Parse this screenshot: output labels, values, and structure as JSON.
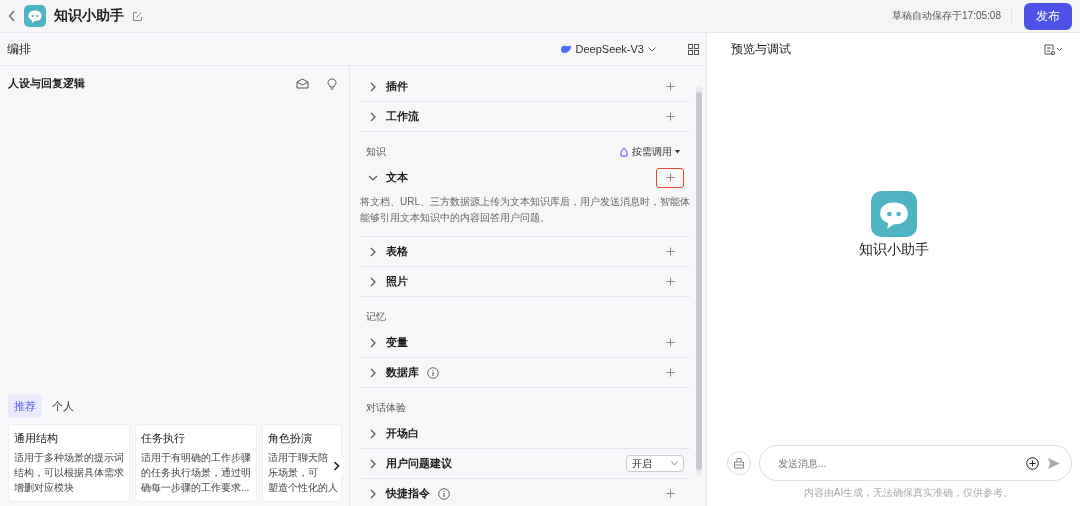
{
  "header": {
    "title": "知识小助手",
    "autosave": "草稿自动保存于17:05:08",
    "publish": "发布"
  },
  "arrange": {
    "title": "编排",
    "model": "DeepSeek-V3"
  },
  "prompt": {
    "title": "人设与回复逻辑",
    "tabs": [
      {
        "label": "推荐",
        "selected": true
      },
      {
        "label": "个人",
        "selected": false
      }
    ],
    "templates": [
      {
        "title": "通用结构",
        "lines": [
          "适用于多种场景的提示词",
          "结构，可以根据具体需求",
          "增删对应模块"
        ]
      },
      {
        "title": "任务执行",
        "lines": [
          "适用于有明确的工作步骤",
          "的任务执行场景，通过明",
          "确每一步骤的工作要求..."
        ]
      },
      {
        "title": "角色扮演",
        "lines": [
          "适用于聊天陪",
          "乐场景，可",
          "塑造个性化的人"
        ]
      }
    ]
  },
  "skills": {
    "sections": [
      {
        "items": [
          {
            "kind": "add",
            "label": "插件",
            "expanded": false,
            "info": false,
            "highlighted": false
          },
          {
            "kind": "add",
            "label": "工作流",
            "expanded": false,
            "info": false,
            "highlighted": false
          }
        ]
      },
      {
        "title": "知识",
        "mode": "按需调用",
        "items": [
          {
            "kind": "add",
            "label": "文本",
            "expanded": true,
            "info": false,
            "highlighted": true,
            "description": "将文档、URL、三方数据源上传为文本知识库后，用户发送消息时，智能体能够引用文本知识中的内容回答用户问题。"
          },
          {
            "kind": "add",
            "label": "表格",
            "expanded": false,
            "info": false,
            "highlighted": false
          },
          {
            "kind": "add",
            "label": "照片",
            "expanded": false,
            "info": false,
            "highlighted": false
          }
        ]
      },
      {
        "title": "记忆",
        "items": [
          {
            "kind": "add",
            "label": "变量",
            "expanded": false,
            "info": false,
            "highlighted": false
          },
          {
            "kind": "add",
            "label": "数据库",
            "expanded": false,
            "info": true,
            "highlighted": false
          }
        ]
      },
      {
        "title": "对话体验",
        "items": [
          {
            "kind": "plain",
            "label": "开场白",
            "expanded": false,
            "info": false
          },
          {
            "kind": "select",
            "label": "用户问题建议",
            "expanded": false,
            "info": false,
            "value": "开启"
          },
          {
            "kind": "add",
            "label": "快捷指令",
            "expanded": false,
            "info": true,
            "highlighted": false
          }
        ]
      }
    ]
  },
  "preview": {
    "title": "预览与调试",
    "bot_name": "知识小助手",
    "input": {
      "placeholder": "发送消息..."
    },
    "disclaimer": "内容由AI生成，无法确保真实准确，仅供参考。"
  }
}
